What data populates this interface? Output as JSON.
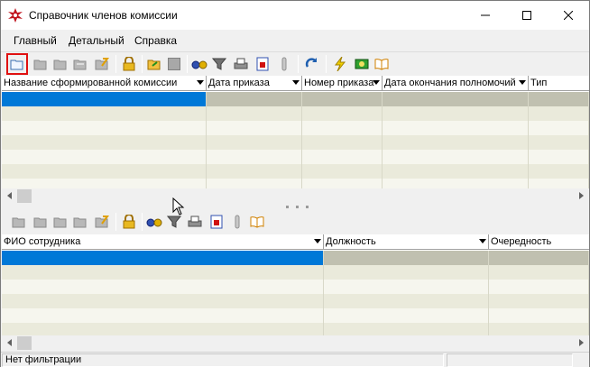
{
  "window": {
    "title": "Справочник членов комиссии"
  },
  "menu": {
    "items": [
      "Главный",
      "Детальный",
      "Справка"
    ]
  },
  "top_grid": {
    "columns": [
      "Название сформированной комиссии",
      "Дата приказа",
      "Номер приказа",
      "Дата окончания полномочий",
      "Тип"
    ]
  },
  "bottom_grid": {
    "columns": [
      "ФИО сотрудника",
      "Должность",
      "Очередность"
    ]
  },
  "status": {
    "filter_text": "Нет фильтрации"
  },
  "colors": {
    "selection": "#0078d7",
    "row_alt": "#eaeadb",
    "active_border": "#e01010"
  },
  "icons": {
    "toolbar_top": [
      "open-folder-icon",
      "folder-add-icon",
      "folder-edit-icon",
      "folder-delete-icon",
      "folder-note-icon",
      "lock-icon",
      "folder-arrow-icon",
      "save-icon",
      "binoculars-icon",
      "filter-icon",
      "print-icon",
      "report-icon",
      "paperclip-icon",
      "refresh-icon",
      "lightning-icon",
      "money-icon",
      "book-icon"
    ],
    "toolbar_bottom": [
      "open-folder-icon",
      "folder-add-icon",
      "folder-edit-icon",
      "folder-delete-icon",
      "folder-note-icon",
      "lock-icon",
      "binoculars-icon",
      "filter-icon",
      "print-icon",
      "report-icon",
      "paperclip-icon",
      "book-icon"
    ]
  }
}
